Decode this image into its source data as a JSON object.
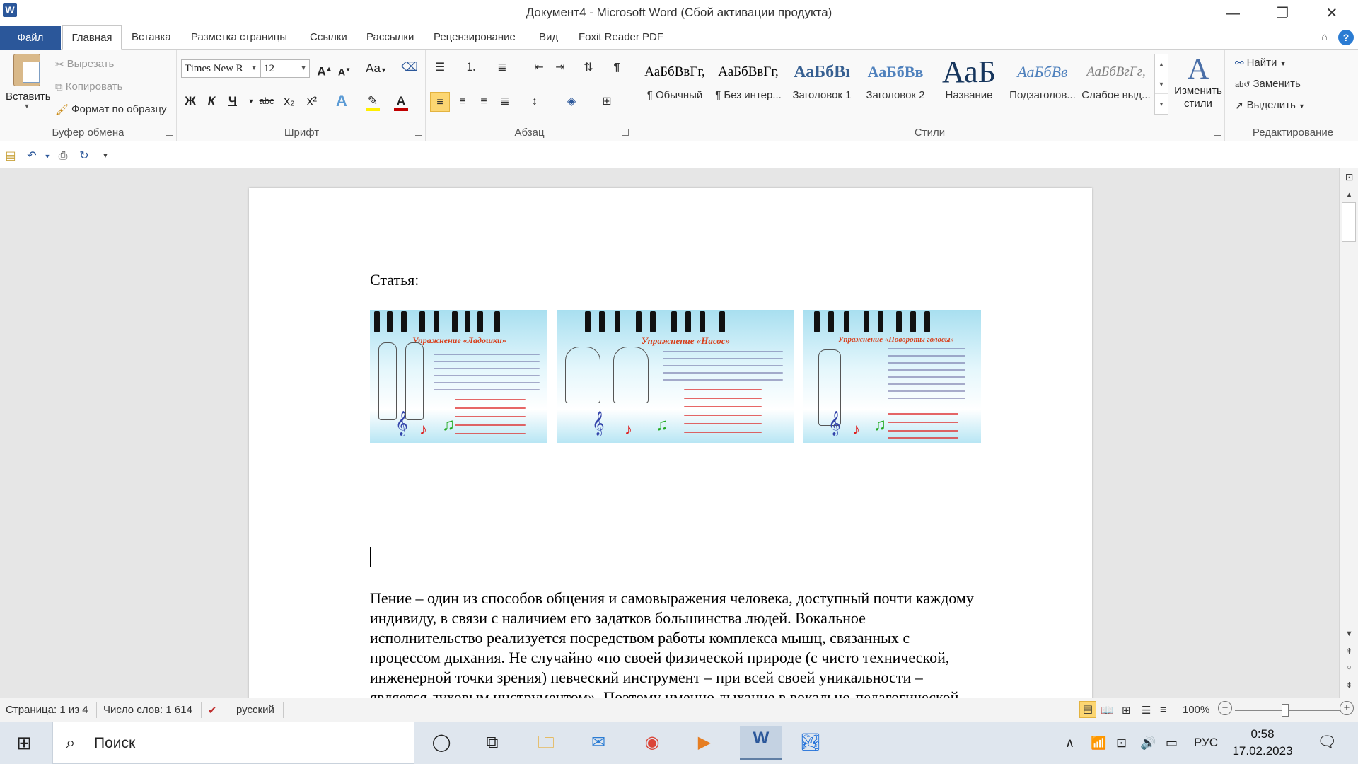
{
  "titlebar": {
    "app_icon": "W",
    "title": "Документ4  -  Microsoft Word (Сбой активации продукта)",
    "minimize": "—",
    "restore": "❐",
    "close": "✕"
  },
  "tabs": [
    "Файл",
    "Главная",
    "Вставка",
    "Разметка страницы",
    "Ссылки",
    "Рассылки",
    "Рецензирование",
    "Вид",
    "Foxit Reader PDF"
  ],
  "ribbon": {
    "clipboard": {
      "label": "Буфер обмена",
      "paste": "Вставить",
      "cut": "Вырезать",
      "copy": "Копировать",
      "format_painter": "Формат по образцу"
    },
    "font": {
      "label": "Шрифт",
      "font_name": "Times New R",
      "font_size": "12",
      "bold": "Ж",
      "italic": "К",
      "underline": "Ч",
      "strike": "abc",
      "subscript": "x₂",
      "superscript": "x²",
      "grow": "A",
      "shrink": "A",
      "case": "Aa"
    },
    "paragraph": {
      "label": "Абзац"
    },
    "styles": {
      "label": "Стили",
      "items": [
        {
          "sample": "АаБбВвГг,",
          "name": "¶ Обычный"
        },
        {
          "sample": "АаБбВвГг,",
          "name": "¶ Без интер..."
        },
        {
          "sample": "АаБбВı",
          "name": "Заголовок 1"
        },
        {
          "sample": "АаБбВв",
          "name": "Заголовок 2"
        },
        {
          "sample": "АаБ",
          "name": "Название"
        },
        {
          "sample": "АаБбВв",
          "name": "Подзаголов..."
        },
        {
          "sample": "АаБбВгГг,",
          "name": "Слабое выд..."
        }
      ],
      "change_styles": "Изменить стили"
    },
    "editing": {
      "label": "Редактирование",
      "find": "Найти",
      "replace": "Заменить",
      "select": "Выделить"
    }
  },
  "document": {
    "heading": "Статья:",
    "images": [
      {
        "title": "Упражнение «Ладошки»"
      },
      {
        "title": "Упражнение «Насос»"
      },
      {
        "title": "Упражнение «Повороты головы»"
      }
    ],
    "paragraph_lines": [
      "Пение – один из способов общения и самовыражения человека, доступный почти каждому",
      "индивиду, в связи с наличием его задатков большинства людей. Вокальное",
      "исполнительство реализуется посредством работы комплекса мышц, связанных с",
      "процессом дыхания. Не случайно «по своей физической природе (с чисто технической,",
      "инженерной точки зрения) певческий инструмент – при всей своей уникальности –",
      "является духовым инструментом». Поэтому именно дыхание в вокально-педагогической"
    ]
  },
  "statusbar": {
    "page": "Страница: 1 из 4",
    "words": "Число слов: 1 614",
    "language": "русский",
    "zoom": "100%"
  },
  "taskbar": {
    "search": "Поиск",
    "lang": "РУС",
    "time": "0:58",
    "date": "17.02.2023"
  }
}
